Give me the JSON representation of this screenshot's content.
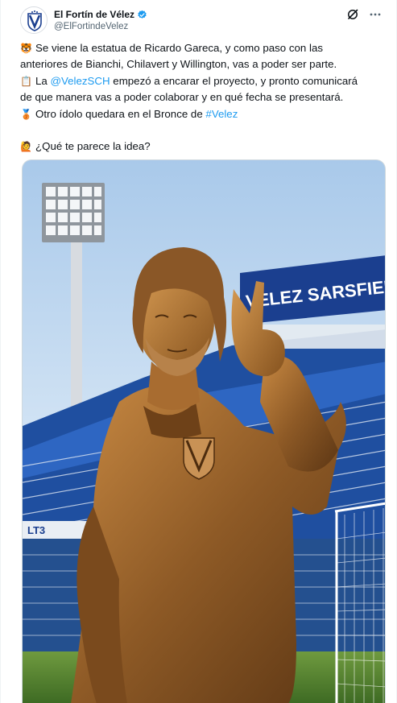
{
  "account": {
    "display_name": "El Fortín de Vélez",
    "handle": "@ElFortindeVelez"
  },
  "icons": {
    "verified": "verified-badge-icon",
    "grok": "grok-icon",
    "more": "more-options-icon"
  },
  "tweet": {
    "lines": [
      {
        "emoji": "🐯",
        "text": "Se viene la estatua de Ricardo Gareca, y como paso con las"
      },
      {
        "text": "anteriores de Bianchi, Chilavert y Willington, vas a poder ser parte."
      },
      {
        "emoji": "📋",
        "text_before": "La ",
        "mention": "@VelezSCH",
        "text_after": " empezó a encarar el proyecto, y pronto comunicará"
      },
      {
        "text": "de que manera vas a poder colaborar y en qué fecha se presentará."
      },
      {
        "emoji": "🥉",
        "text_before": "Otro ídolo quedara en el Bronce de ",
        "hashtag": "#Velez"
      },
      {
        "emoji": "🙋",
        "text": "¿Qué te parece la idea?"
      }
    ]
  },
  "media": {
    "stadium_sign": "VELEZ SARSFIELD",
    "board_text": "LT3"
  },
  "colors": {
    "link": "#1d9bf0",
    "verified": "#1d9bf0",
    "text": "#0f1419",
    "secondary": "#536471"
  }
}
